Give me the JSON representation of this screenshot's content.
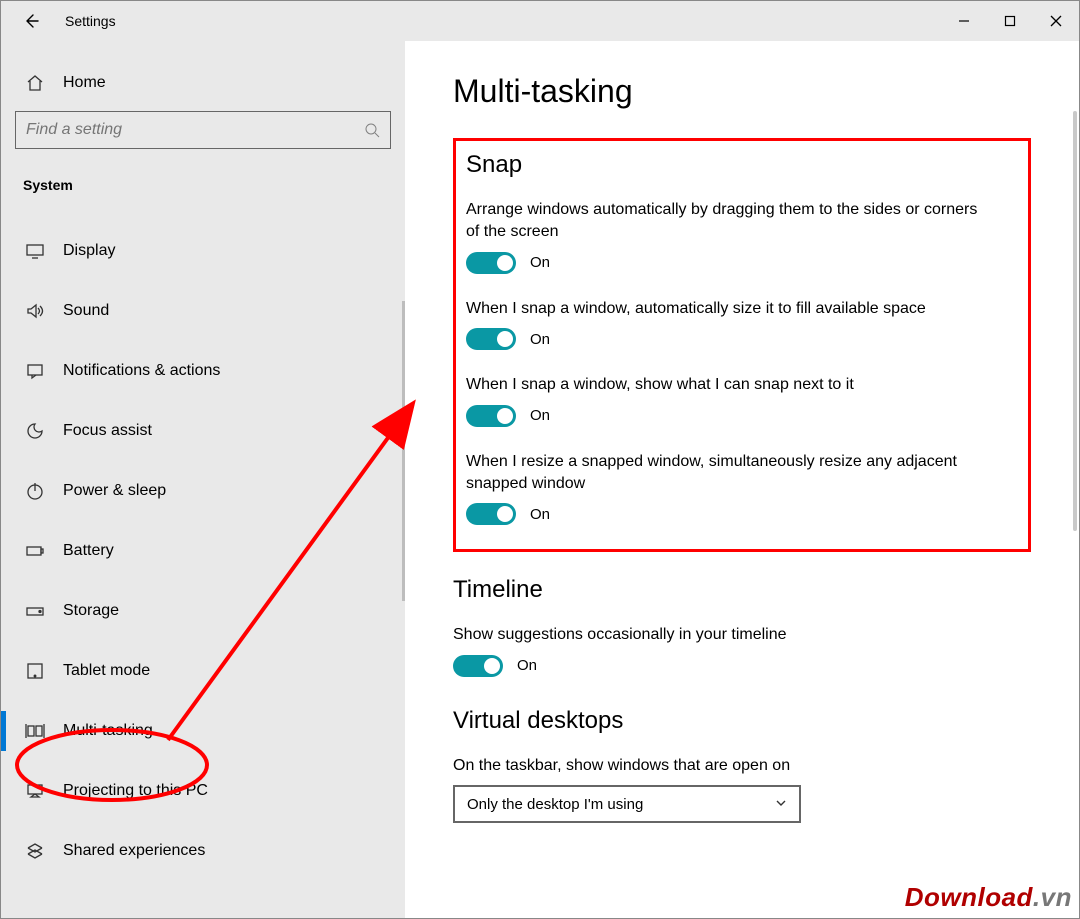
{
  "titlebar": {
    "title": "Settings"
  },
  "sidebar": {
    "home_label": "Home",
    "search_placeholder": "Find a setting",
    "group_label": "System",
    "items": [
      {
        "label": "Display"
      },
      {
        "label": "Sound"
      },
      {
        "label": "Notifications & actions"
      },
      {
        "label": "Focus assist"
      },
      {
        "label": "Power & sleep"
      },
      {
        "label": "Battery"
      },
      {
        "label": "Storage"
      },
      {
        "label": "Tablet mode"
      },
      {
        "label": "Multi-tasking"
      },
      {
        "label": "Projecting to this PC"
      },
      {
        "label": "Shared experiences"
      }
    ]
  },
  "content": {
    "page_title": "Multi-tasking",
    "snap": {
      "heading": "Snap",
      "items": [
        {
          "desc": "Arrange windows automatically by dragging them to the sides or corners of the screen",
          "state": "On"
        },
        {
          "desc": "When I snap a window, automatically size it to fill available space",
          "state": "On"
        },
        {
          "desc": "When I snap a window, show what I can snap next to it",
          "state": "On"
        },
        {
          "desc": "When I resize a snapped window, simultaneously resize any adjacent snapped window",
          "state": "On"
        }
      ]
    },
    "timeline": {
      "heading": "Timeline",
      "desc": "Show suggestions occasionally in your timeline",
      "state": "On"
    },
    "virtual_desktops": {
      "heading": "Virtual desktops",
      "dropdown_label": "On the taskbar, show windows that are open on",
      "dropdown_value": "Only the desktop I'm using"
    }
  },
  "watermark": {
    "brand": "Download",
    "tld": ".vn"
  }
}
